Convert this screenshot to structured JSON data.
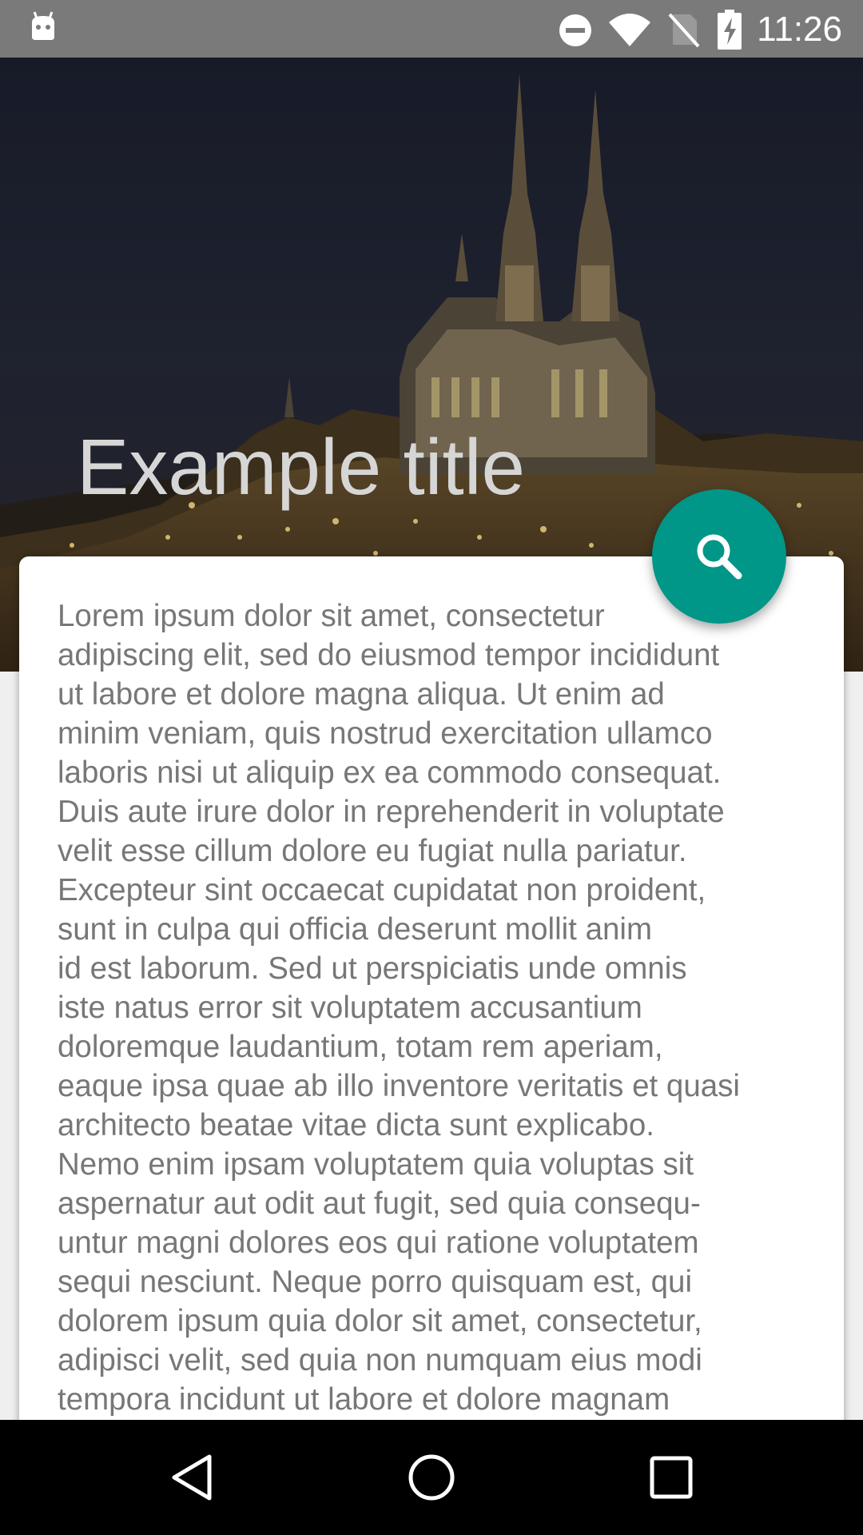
{
  "status_bar": {
    "time": "11:26",
    "icons": [
      "android-icon",
      "do-not-disturb-icon",
      "wifi-icon",
      "no-sim-icon",
      "battery-charging-icon"
    ]
  },
  "header": {
    "title": "Example title"
  },
  "fab": {
    "icon": "search-icon",
    "color": "#009688"
  },
  "content": {
    "body": "Lorem ipsum dolor sit amet, consectetur\nadipiscing elit, sed do eiusmod tempor incididunt\nut labore et dolore magna aliqua. Ut enim ad\nminim veniam, quis nostrud exercitation ullamco\nlaboris nisi ut aliquip ex ea commodo consequat.\nDuis aute irure dolor in reprehenderit in voluptate\nvelit esse cillum dolore eu fugiat nulla pariatur.\nExcepteur sint occaecat cupidatat non proident,\nsunt in culpa qui officia deserunt mollit anim\nid est laborum. Sed ut perspiciatis unde omnis\niste natus error sit voluptatem accusantium\ndoloremque laudantium, totam rem aperiam,\neaque ipsa quae ab illo inventore veritatis et quasi\narchitecto beatae vitae dicta sunt explicabo.\nNemo enim ipsam voluptatem quia voluptas sit\naspernatur aut odit aut fugit, sed quia consequ-\nuntur magni dolores eos qui ratione voluptatem\nsequi nesciunt. Neque porro quisquam est, qui\ndolorem ipsum quia dolor sit amet, consectetur,\nadipisci velit, sed quia non numquam eius modi\ntempora incidunt ut labore et dolore magnam"
  },
  "nav_bar": {
    "buttons": [
      "back-icon",
      "home-icon",
      "recents-icon"
    ]
  },
  "colors": {
    "accent": "#009688",
    "status_bar": "#7a7a7a",
    "nav_bar": "#000000",
    "card": "#ffffff",
    "body_text": "#777777"
  }
}
